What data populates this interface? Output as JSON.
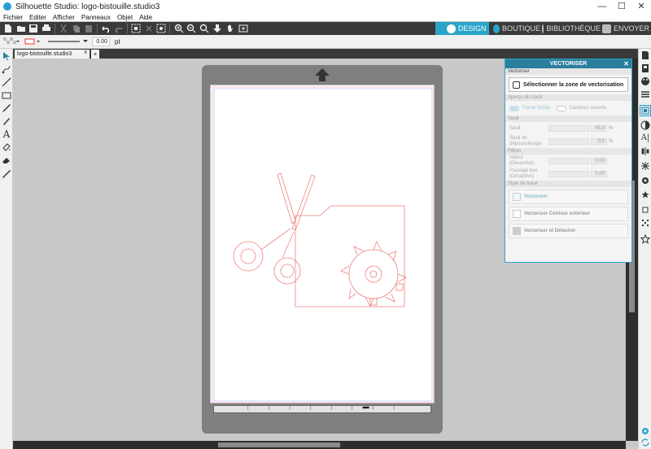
{
  "window": {
    "title": "Silhouette Studio: logo-bistouille.studio3",
    "minimize": "—",
    "maximize": "☐",
    "close": "✕"
  },
  "menu": [
    "Fichier",
    "Editer",
    "Afficher",
    "Panneaux",
    "Objet",
    "Aide"
  ],
  "nav_tabs": [
    {
      "label": "DESIGN",
      "active": true
    },
    {
      "label": "BOUTIQUE",
      "active": false
    },
    {
      "label": "BIBLIOTHÈQUE",
      "active": false
    },
    {
      "label": "ENVOYER",
      "active": false
    }
  ],
  "line_style": {
    "width_value": "0.00",
    "unit": "pt"
  },
  "document_tab": {
    "name": "logo-bistouille.studio3",
    "close": "x",
    "add": "+"
  },
  "vectorise_panel": {
    "title": "VECTORISER",
    "close": "✕",
    "section_main": "Vectoriser",
    "select_area_button": "Sélectionner la zone de vectorisation",
    "section_preview": "Aperçu du tracé",
    "preview_solid": "Trame Solide",
    "preview_outline": "Contours ouverts",
    "section_threshold": "Seuil",
    "threshold_label": "Seuil",
    "threshold_value": "45,0",
    "threshold_unit": "%",
    "despeckle_label": "Seuil de dépoussiérage",
    "despeckle_value": "0,0",
    "despeckle_unit": "%",
    "section_filters": "Filtres",
    "scale_label": "Valeur (Désactivé)",
    "scale_value": "0,00",
    "lowpass_label": "Passage bas (Désactivé)",
    "lowpass_value": "0,00",
    "section_trace_style": "Style de tracé",
    "trace_button": "Vectoriser",
    "trace_outer_button": "Vectoriser Contour extérieur",
    "trace_detach_button": "Vectoriser et Détacher"
  },
  "colors": {
    "accent": "#2aa5c9",
    "panel_header": "#2a7f9e",
    "cut_line": "#f08080",
    "margin_line": "#b0b0ff"
  }
}
